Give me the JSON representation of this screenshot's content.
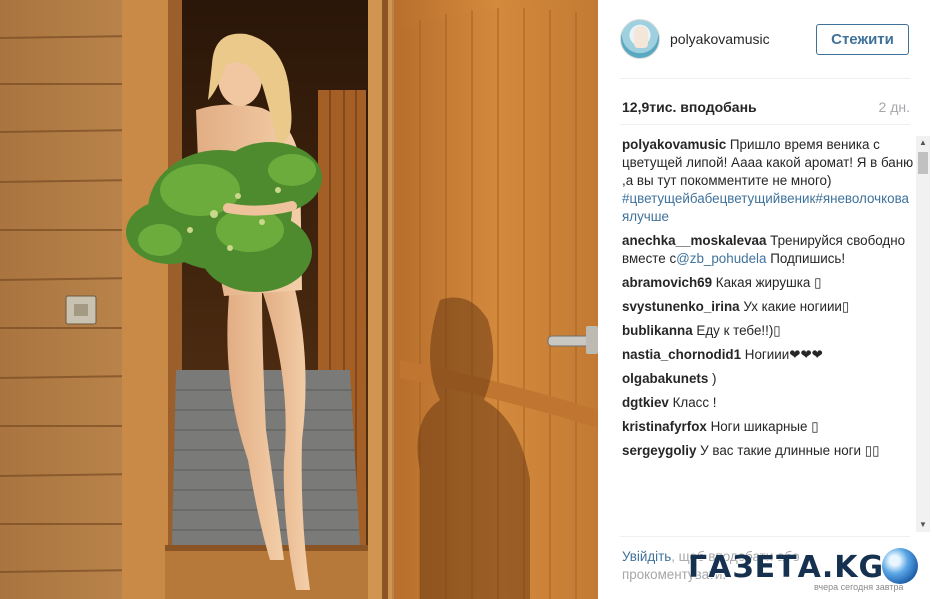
{
  "post": {
    "username": "polyakovamusic",
    "follow_label": "Стежити",
    "likes": "12,9тис. вподобань",
    "time": "2 дн."
  },
  "comments": [
    {
      "author": "polyakovamusic",
      "text": " Пришло время веника с цветущей липой! Аааа какой аромат! Я в баню ,а вы тут покомментите не много) ",
      "hashtag": "#цветущейбабецветущийвеник#яневолочковаялучше"
    },
    {
      "author": "anechka__moskalevaa",
      "text": " Тренируйся свободно вместе с",
      "mention": "@zb_pohudela",
      "text2": " Подпишись!"
    },
    {
      "author": "abramovich69",
      "text": " Какая жирушка ▯"
    },
    {
      "author": "svystunenko_irina",
      "text": " Ух какие ногиии▯"
    },
    {
      "author": "bublikanna",
      "text": " Еду к тебе!!)▯"
    },
    {
      "author": "nastia_chornodid1",
      "text": " Ногиии❤❤❤"
    },
    {
      "author": "olgabakunets",
      "text": " )"
    },
    {
      "author": "dgtkiev",
      "text": " Класс !"
    },
    {
      "author": "kristinafyrfox",
      "text": " Ноги шикарные ▯"
    },
    {
      "author": "sergeygoliy",
      "text": " У вас такие длинные ноги ▯▯"
    }
  ],
  "footer": {
    "login_link": "Увійдіть",
    "login_text": ", щоб вподобати або прокоментувати."
  },
  "watermark": {
    "brand": "ГАЗЕТА.KG",
    "tagline": "вчера сегодня завтра"
  },
  "icons": {
    "scroll_up": "scroll-up-arrow",
    "scroll_down": "scroll-down-arrow",
    "globe": "globe-logo"
  },
  "colors": {
    "accent": "#3f729b",
    "muted": "#a5a7aa",
    "text": "#262626"
  }
}
